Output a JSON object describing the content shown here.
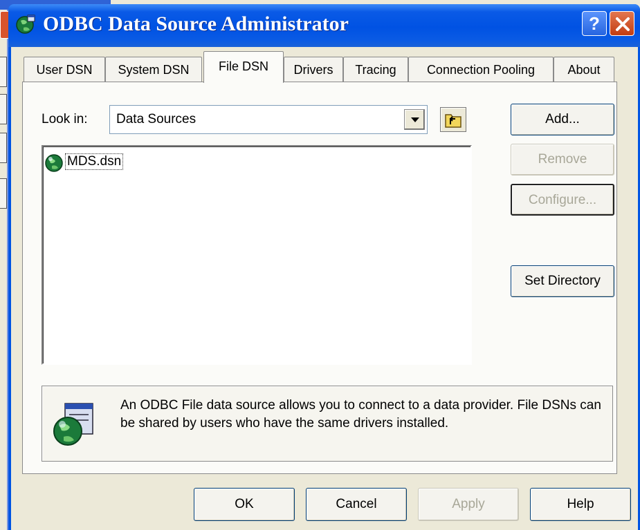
{
  "window": {
    "title": "ODBC Data Source Administrator",
    "help_label": "?"
  },
  "tabs": [
    {
      "label": "User DSN"
    },
    {
      "label": "System DSN"
    },
    {
      "label": "File DSN",
      "active": true
    },
    {
      "label": "Drivers"
    },
    {
      "label": "Tracing"
    },
    {
      "label": "Connection Pooling"
    },
    {
      "label": "About"
    }
  ],
  "look_in": {
    "label": "Look in:",
    "value": "Data Sources"
  },
  "files": [
    {
      "name": "MDS.dsn"
    }
  ],
  "side_buttons": {
    "add": "Add...",
    "remove": "Remove",
    "configure": "Configure...",
    "set_directory": "Set Directory"
  },
  "info": {
    "text": "An ODBC File data source allows you to connect to a data provider.  File DSNs can be shared by users who have the same drivers installed."
  },
  "footer": {
    "ok": "OK",
    "cancel": "Cancel",
    "apply": "Apply",
    "help": "Help"
  },
  "colors": {
    "titlebar": "#0054E3",
    "dialog_bg": "#ECE9D8",
    "close_red": "#C33D12"
  },
  "icons": [
    "odbc-globe-icon",
    "help-icon",
    "close-icon",
    "dropdown-arrow-icon",
    "up-folder-icon",
    "dsn-file-icon",
    "odbc-info-icon"
  ]
}
